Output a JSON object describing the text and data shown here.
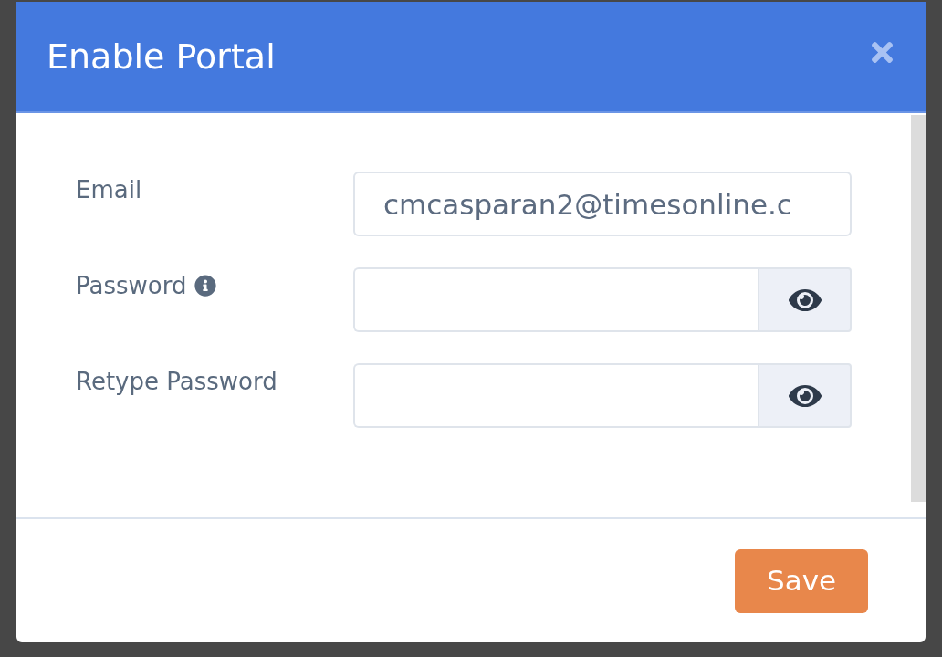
{
  "dialog": {
    "title": "Enable Portal"
  },
  "fields": [
    {
      "kind": "email",
      "label": "Email",
      "value": "cmcasparan2@timesonline.c",
      "info_icon": false
    },
    {
      "kind": "password",
      "label": "Password",
      "info_icon": true
    },
    {
      "kind": "password",
      "label": "Retype Password",
      "info_icon": false
    }
  ],
  "footer_buttons": [
    "Save"
  ]
}
